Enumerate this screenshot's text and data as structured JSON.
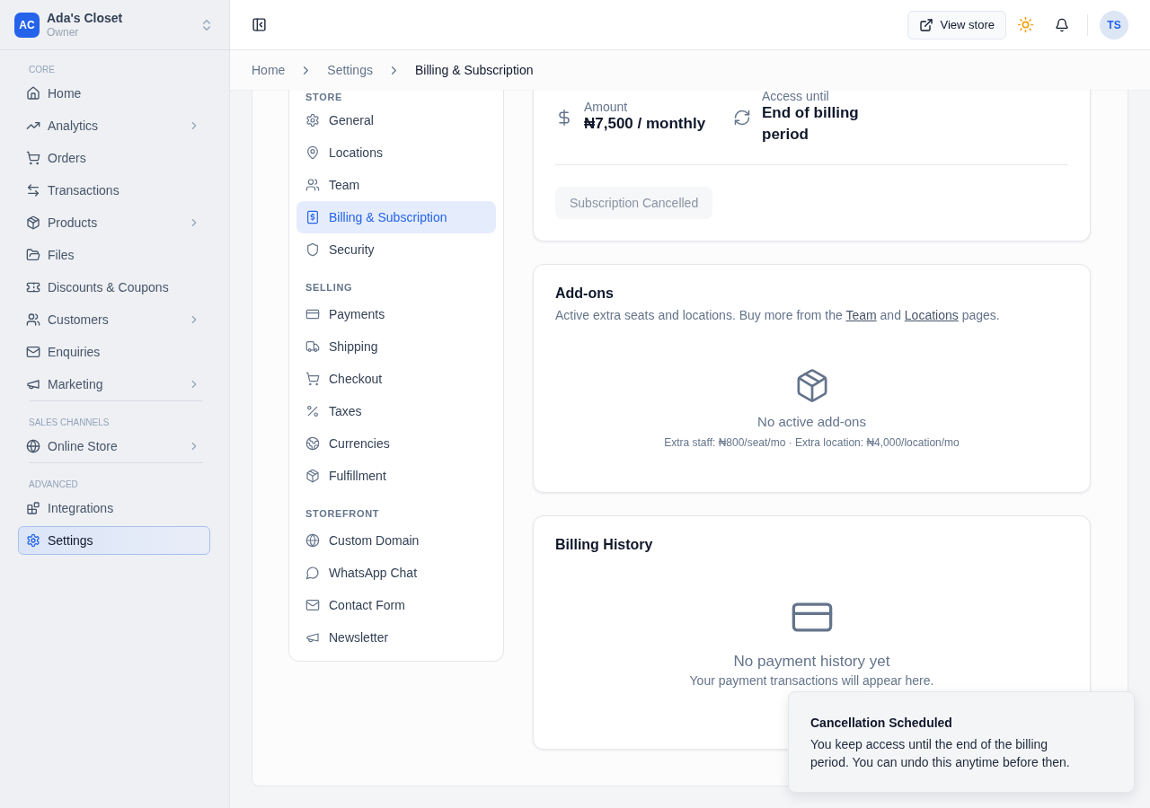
{
  "sidebar": {
    "brand": {
      "initials": "AC",
      "name": "Ada's Closet",
      "role": "Owner"
    },
    "sections": [
      {
        "label": "CORE",
        "items": [
          {
            "label": "Home",
            "has_children": false,
            "selected": false
          },
          {
            "label": "Analytics",
            "has_children": true,
            "selected": false
          },
          {
            "label": "Orders",
            "has_children": false,
            "selected": false
          },
          {
            "label": "Transactions",
            "has_children": false,
            "selected": false
          },
          {
            "label": "Products",
            "has_children": true,
            "selected": false
          },
          {
            "label": "Files",
            "has_children": false,
            "selected": false
          },
          {
            "label": "Discounts & Coupons",
            "has_children": false,
            "selected": false
          },
          {
            "label": "Customers",
            "has_children": true,
            "selected": false
          },
          {
            "label": "Enquiries",
            "has_children": false,
            "selected": false
          },
          {
            "label": "Marketing",
            "has_children": true,
            "selected": false
          }
        ]
      },
      {
        "label": "SALES CHANNELS",
        "items": [
          {
            "label": "Online Store",
            "has_children": true,
            "selected": false
          }
        ]
      },
      {
        "label": "ADVANCED",
        "items": [
          {
            "label": "Integrations",
            "has_children": false,
            "selected": false
          },
          {
            "label": "Settings",
            "has_children": false,
            "selected": true
          }
        ]
      }
    ]
  },
  "topbar": {
    "view_store": "View store",
    "avatar": "TS"
  },
  "breadcrumbs": [
    {
      "label": "Home",
      "current": false
    },
    {
      "label": "Settings",
      "current": false
    },
    {
      "label": "Billing & Subscription",
      "current": true
    }
  ],
  "settings_nav": [
    {
      "label": "STORE",
      "items": [
        {
          "label": "General",
          "selected": false
        },
        {
          "label": "Locations",
          "selected": false
        },
        {
          "label": "Team",
          "selected": false
        },
        {
          "label": "Billing & Subscription",
          "selected": true
        },
        {
          "label": "Security",
          "selected": false
        }
      ]
    },
    {
      "label": "SELLING",
      "items": [
        {
          "label": "Payments",
          "selected": false
        },
        {
          "label": "Shipping",
          "selected": false
        },
        {
          "label": "Checkout",
          "selected": false
        },
        {
          "label": "Taxes",
          "selected": false
        },
        {
          "label": "Currencies",
          "selected": false
        },
        {
          "label": "Fulfillment",
          "selected": false
        }
      ]
    },
    {
      "label": "STOREFRONT",
      "items": [
        {
          "label": "Custom Domain",
          "selected": false
        },
        {
          "label": "WhatsApp Chat",
          "selected": false
        },
        {
          "label": "Contact Form",
          "selected": false
        },
        {
          "label": "Newsletter",
          "selected": false
        }
      ]
    }
  ],
  "subscription": {
    "details": [
      {
        "kind": "amount",
        "label": "Amount",
        "value": "₦7,500 / monthly"
      },
      {
        "kind": "renewal",
        "label": "Access until",
        "value": "End of billing period"
      }
    ],
    "action": {
      "label": "Subscription Cancelled",
      "disabled": true
    }
  },
  "addons": {
    "title": "Add-ons",
    "description": [
      {
        "text": "Active extra seats and locations. Buy more from the ",
        "link": false
      },
      {
        "text": "Team",
        "link": true
      },
      {
        "text": " and ",
        "link": false
      },
      {
        "text": "Locations",
        "link": true
      },
      {
        "text": " pages.",
        "link": false
      }
    ],
    "empty_title": "No active add-ons",
    "empty_note": "Extra staff: ₦800/seat/mo · Extra location: ₦4,000/location/mo"
  },
  "billing_history": {
    "title": "Billing History",
    "empty_title": "No payment history yet",
    "empty_note": "Your payment transactions will appear here."
  },
  "toast": {
    "title": "Cancellation Scheduled",
    "message": "You keep access until the end of the billing period. You can undo this anytime before then."
  }
}
